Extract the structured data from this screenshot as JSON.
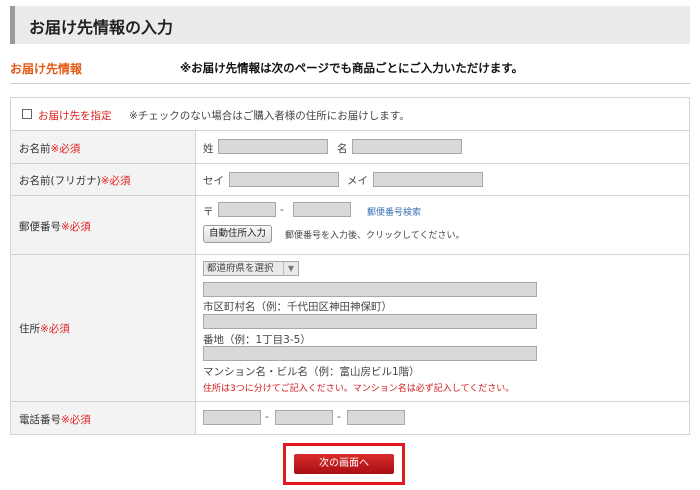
{
  "page_title": "お届け先情報の入力",
  "section_label": "お届け先情報",
  "section_note": "※お届け先情報は次のページでも商品ごとにご入力いただけます。",
  "designate": {
    "label": "お届け先を指定",
    "note": "※チェックのない場合はご購入者様の住所にお届けします。"
  },
  "required_mark": "※必須",
  "name": {
    "label": "お名前",
    "last_label": "姓",
    "first_label": "名"
  },
  "kana": {
    "label": "お名前(フリガナ)",
    "last_label": "セイ",
    "first_label": "メイ"
  },
  "postal": {
    "label": "郵便番号",
    "prefix": "〒",
    "separator": "-",
    "lookup_link": "郵便番号検索",
    "auto_button": "自動住所入力",
    "auto_hint": "郵便番号を入力後、クリックしてください。"
  },
  "address": {
    "label": "住所",
    "prefecture_selected": "都道府県を選択",
    "city_caption": "市区町村名（例：千代田区神田神保町）",
    "block_caption": "番地（例：1丁目3-5）",
    "building_caption": "マンション名・ビル名（例：富山房ビル1階）",
    "note": "住所は3つに分けてご記入ください。マンション名は必ず記入してください。"
  },
  "phone": {
    "label": "電話番号",
    "separator": "-"
  },
  "next_button": "次の画面へ",
  "colors": {
    "accent_orange": "#e35a16",
    "required_red": "#e02020",
    "button_red": "#c01a1f",
    "highlight_border": "#e4191f"
  }
}
